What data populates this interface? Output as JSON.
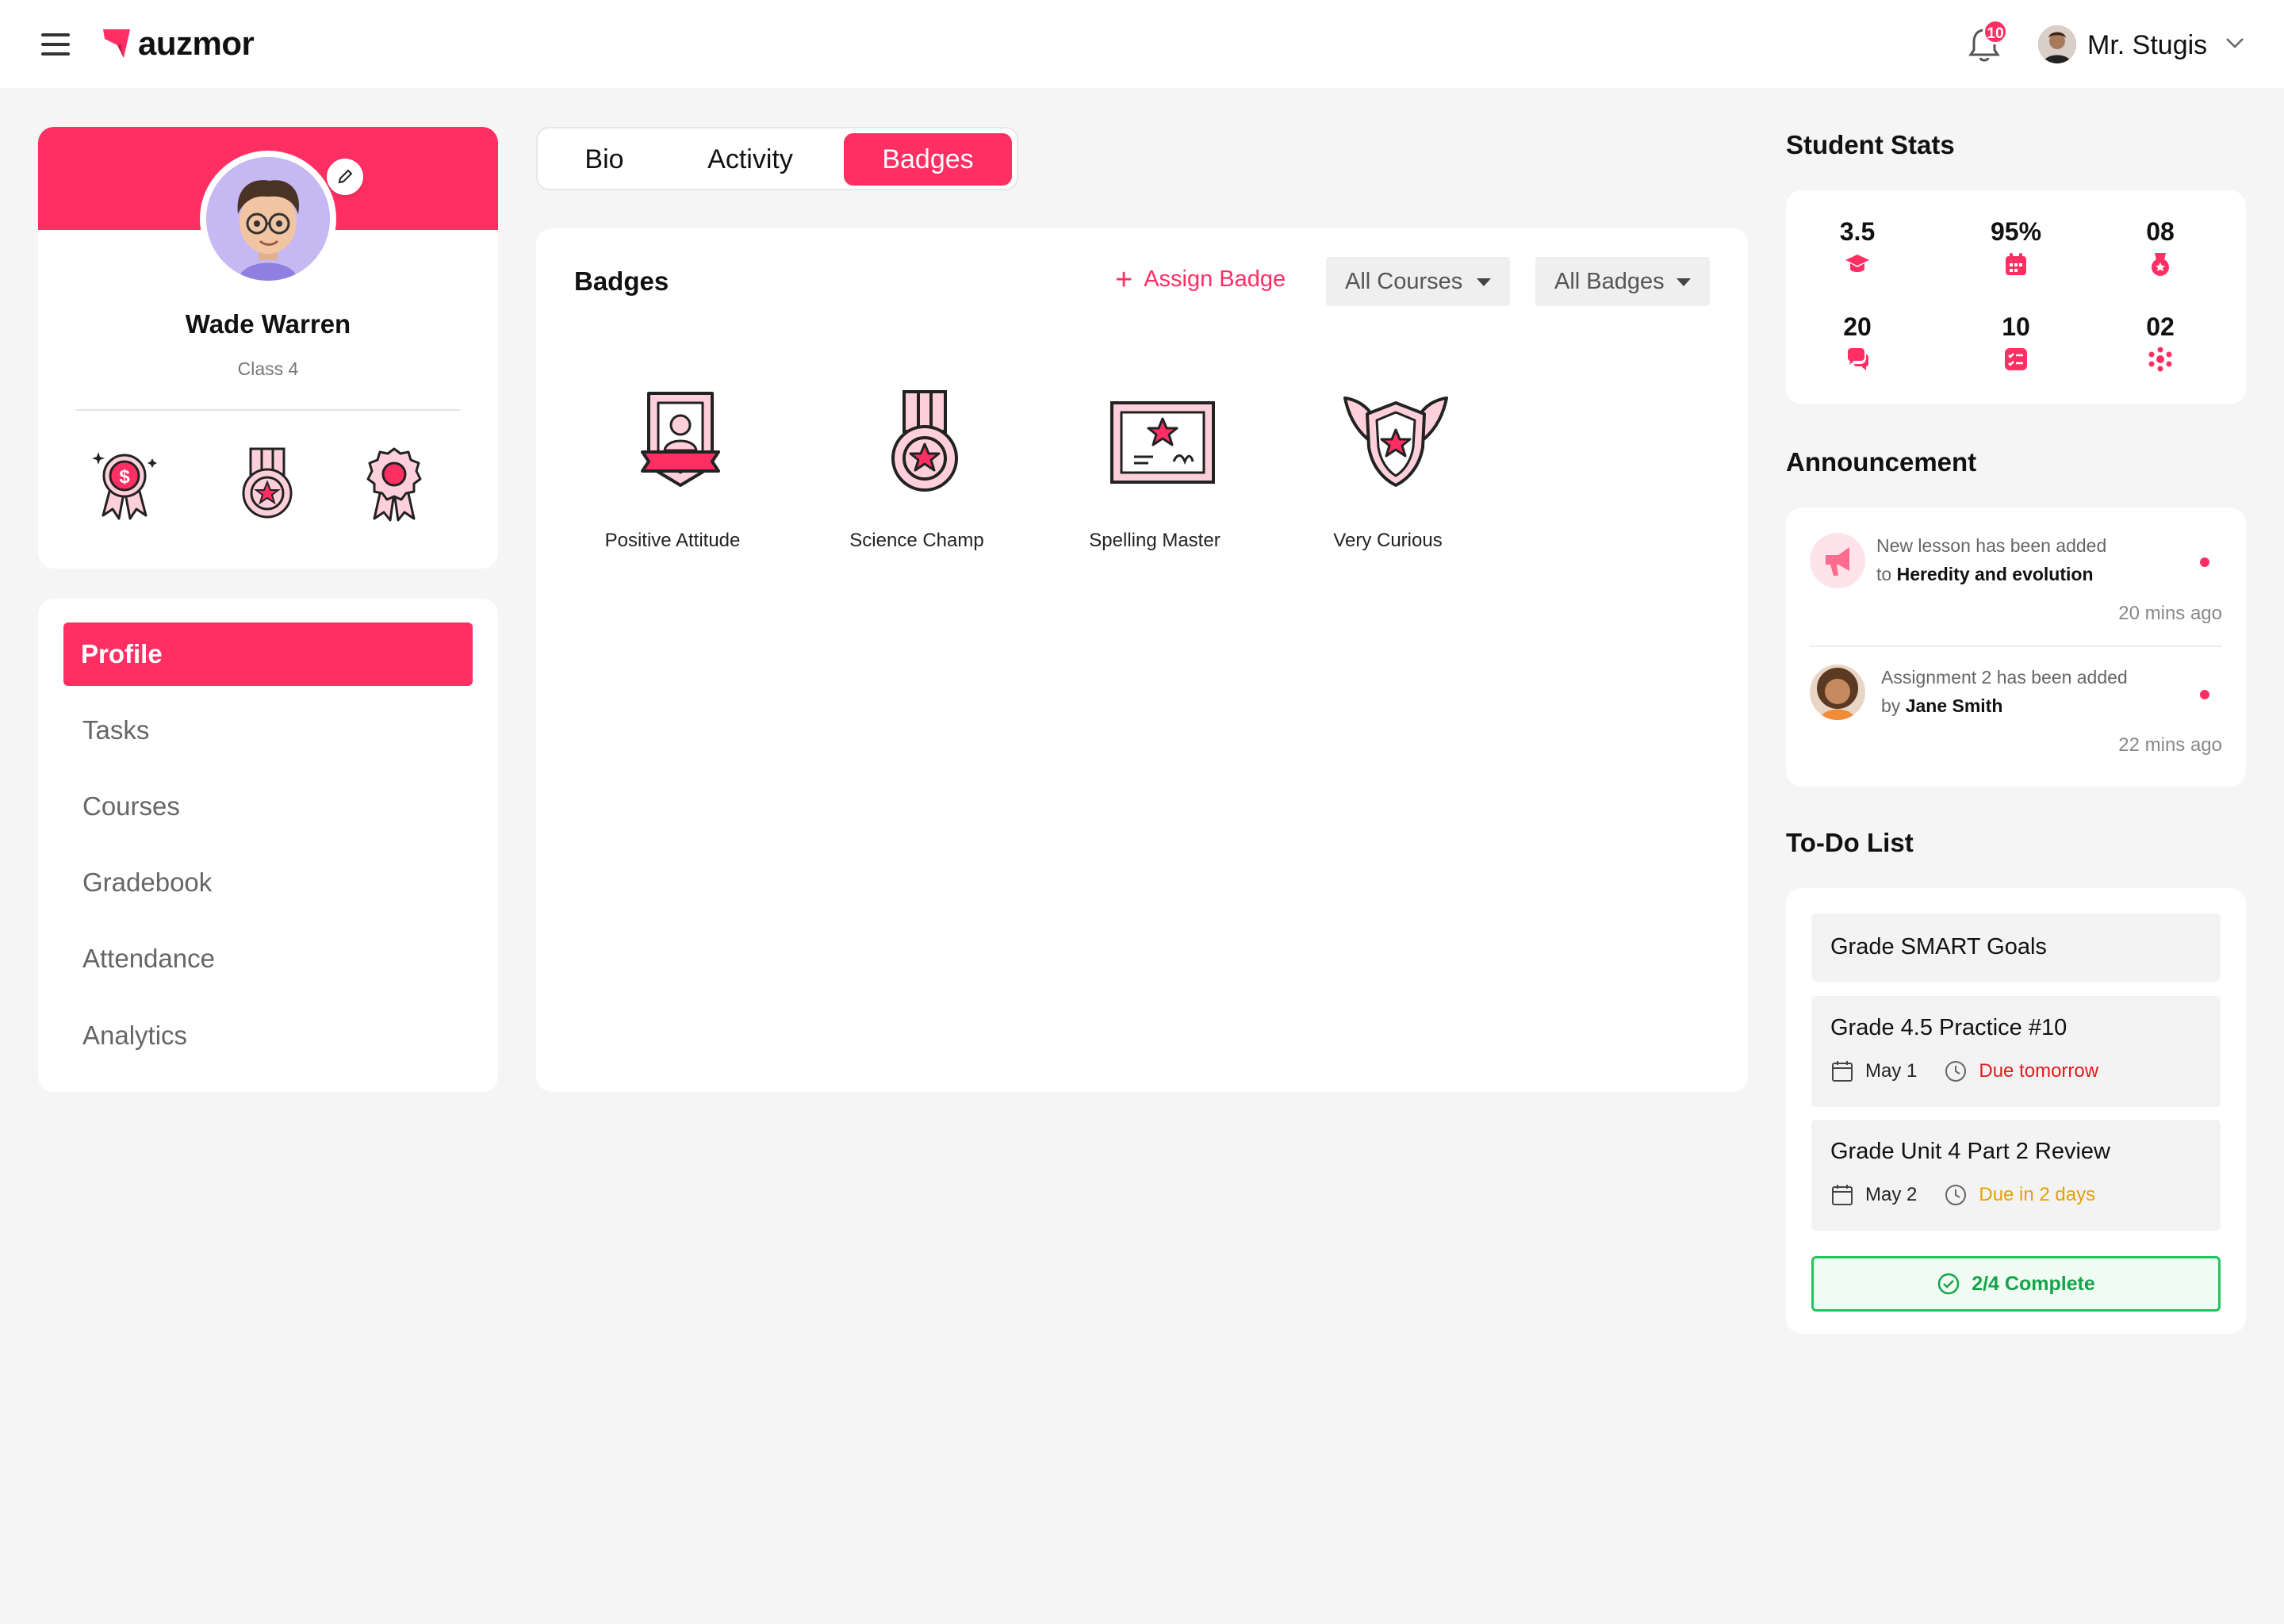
{
  "app": {
    "brand": "auzmor",
    "notifications_count": "10",
    "user_name": "Mr. Stugis"
  },
  "profile": {
    "name": "Wade Warren",
    "class": "Class 4",
    "mini_badges": [
      "dollar-award-icon",
      "star-medal-icon",
      "rosette-icon"
    ]
  },
  "nav": {
    "items": [
      "Profile",
      "Tasks",
      "Courses",
      "Gradebook",
      "Attendance",
      "Analytics"
    ],
    "active": "Profile"
  },
  "tabs": {
    "items": [
      "Bio",
      "Activity",
      "Badges"
    ],
    "active": "Badges"
  },
  "badges_panel": {
    "title": "Badges",
    "assign_label": "Assign Badge",
    "courses_filter": "All Courses",
    "badges_filter": "All Badges",
    "badges": [
      {
        "label": "Positive Attitude",
        "icon": "certificate-badge-icon"
      },
      {
        "label": "Science Champ",
        "icon": "star-medal-icon"
      },
      {
        "label": "Spelling Master",
        "icon": "certificate-icon"
      },
      {
        "label": "Very Curious",
        "icon": "winged-shield-icon"
      }
    ]
  },
  "stats": {
    "title": "Student Stats",
    "items": [
      {
        "value": "3.5",
        "icon": "graduation-cap-icon"
      },
      {
        "value": "95%",
        "icon": "calendar-icon"
      },
      {
        "value": "08",
        "icon": "medal-icon"
      },
      {
        "value": "20",
        "icon": "chat-icon"
      },
      {
        "value": "10",
        "icon": "checklist-icon"
      },
      {
        "value": "02",
        "icon": "group-icon"
      }
    ]
  },
  "announcement": {
    "title": "Announcement",
    "items": [
      {
        "line1": "New lesson has been added",
        "prefix": "to",
        "bold": "Heredity and evolution",
        "time": "20 mins ago"
      },
      {
        "line1": "Assignment 2 has been added",
        "prefix": "by",
        "bold": "Jane Smith",
        "time": "22 mins ago"
      }
    ]
  },
  "todo": {
    "title": "To-Do List",
    "items": [
      {
        "title": "Grade SMART Goals"
      },
      {
        "title": "Grade 4.5 Practice #10",
        "date": "May 1",
        "due": "Due tomorrow"
      },
      {
        "title": "Grade Unit 4 Part 2 Review",
        "date": "May 2",
        "due": "Due in 2 days"
      }
    ],
    "complete_label": "2/4 Complete"
  },
  "colors": {
    "accent": "#ff2f64",
    "success": "#22c55e",
    "due_urgent": "#e21a1a",
    "due_soon": "#e6a100"
  }
}
